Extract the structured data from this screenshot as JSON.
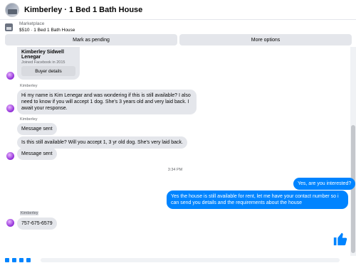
{
  "header": {
    "title": "Kimberley · 1 Bed 1 Bath House"
  },
  "listing": {
    "label": "Marketplace",
    "value": "$510 · 1 Bed 1 Bath House"
  },
  "actions": {
    "pending": "Mark as pending",
    "more": "More options"
  },
  "card": {
    "name": "Kimberley Sidwell Lenegar",
    "joined": "Joined Facebook in 2015",
    "button": "Buyer details"
  },
  "messages": {
    "sender1": "Kimberley",
    "m1": "Hi my name is Kim Lenegar and was wondering if this is still available? I also need to know if you will accept 1 dog. She's 3 years old and very laid back. I await your response.",
    "sender2": "Kimberley",
    "m2": "Message sent",
    "m3": "Is this still available? Will you accept 1, 3 yr old dog. She's very laid back.",
    "m4": "Message sent",
    "time": "3:34 PM",
    "o1": "Yes, are you interested?",
    "o2": "Yes the house is still available for rent, let me have your contact number so i can send you details and the requirements about the house",
    "sender3": "Kimberley",
    "m5": "757-675-6579"
  },
  "colors": {
    "outgoing": "#0084ff",
    "incoming": "#e4e6eb",
    "accent": "#0084ff"
  },
  "icons": {
    "like": "thumbs-up-icon"
  }
}
